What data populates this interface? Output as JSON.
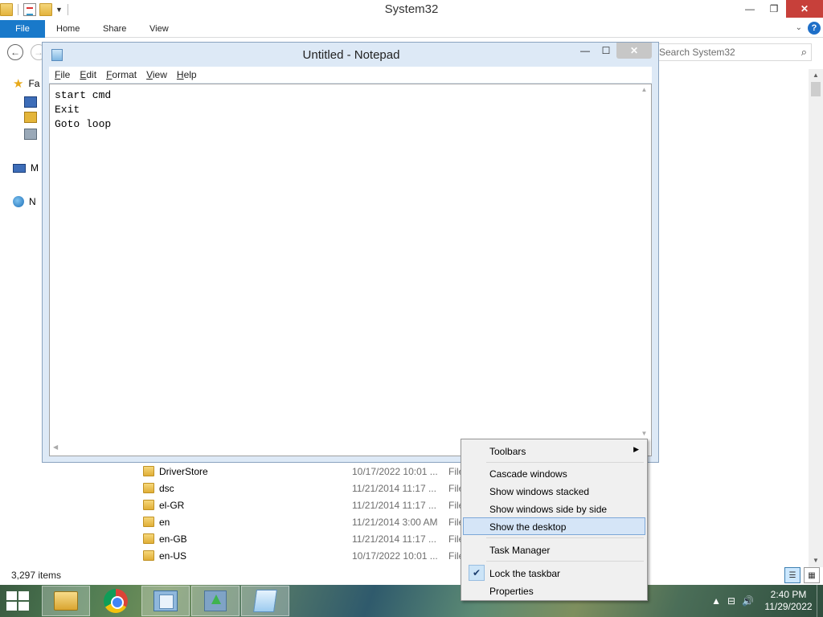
{
  "explorer": {
    "title": "System32",
    "ribbon_tabs": [
      "File",
      "Home",
      "Share",
      "View"
    ],
    "search_placeholder": "Search System32",
    "nav_items": [
      "Fa",
      "M",
      "N"
    ],
    "files": [
      {
        "name": "DriverStore",
        "date": "10/17/2022 10:01 ...",
        "type": "File"
      },
      {
        "name": "dsc",
        "date": "11/21/2014 11:17 ...",
        "type": "File"
      },
      {
        "name": "el-GR",
        "date": "11/21/2014 11:17 ...",
        "type": "File"
      },
      {
        "name": "en",
        "date": "11/21/2014 3:00 AM",
        "type": "File"
      },
      {
        "name": "en-GB",
        "date": "11/21/2014 11:17 ...",
        "type": "File"
      },
      {
        "name": "en-US",
        "date": "10/17/2022 10:01 ...",
        "type": "File"
      }
    ],
    "status_text": "3,297 items"
  },
  "notepad": {
    "title": "Untitled - Notepad",
    "menus": [
      {
        "first": "F",
        "rest": "ile"
      },
      {
        "first": "E",
        "rest": "dit"
      },
      {
        "first": "F",
        "rest": "ormat"
      },
      {
        "first": "V",
        "rest": "iew"
      },
      {
        "first": "H",
        "rest": "elp"
      }
    ],
    "content": "start cmd\nExit\nGoto loop"
  },
  "context_menu": {
    "items": [
      "Toolbars",
      "Cascade windows",
      "Show windows stacked",
      "Show windows side by side",
      "Show the desktop",
      "Task Manager",
      "Lock the taskbar",
      "Properties"
    ],
    "highlighted": "Show the desktop",
    "checked": "Lock the taskbar"
  },
  "taskbar": {
    "time": "2:40 PM",
    "date": "11/29/2022",
    "apps": [
      "file-explorer",
      "chrome",
      "control-panel",
      "upload-tool",
      "notepad"
    ]
  },
  "colors": {
    "file_tab": "#1979ca",
    "close_button": "#c7403a",
    "menu_highlight": "#d5e5f7"
  }
}
